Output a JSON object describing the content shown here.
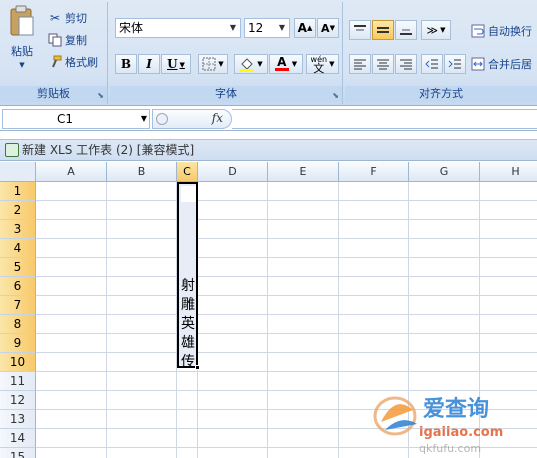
{
  "ribbon": {
    "clipboard": {
      "paste": "粘贴",
      "cut": "剪切",
      "copy": "复制",
      "format_painter": "格式刷",
      "group_label": "剪贴板"
    },
    "font": {
      "name": "宋体",
      "size": "12",
      "grow": "A",
      "shrink": "A",
      "bold": "B",
      "italic": "I",
      "underline": "U",
      "font_color_letter": "A",
      "phonetic": "wén",
      "group_label": "字体"
    },
    "alignment": {
      "wrap_text": "自动换行",
      "merge_center": "合并后居",
      "group_label": "对齐方式"
    }
  },
  "formula_bar": {
    "name_box": "C1",
    "fx": "fx",
    "value": ""
  },
  "window": {
    "title": "新建 XLS 工作表 (2)  [兼容模式]"
  },
  "sheet": {
    "columns": [
      "A",
      "B",
      "C",
      "D",
      "E",
      "F",
      "G",
      "H"
    ],
    "rows": [
      "1",
      "2",
      "3",
      "4",
      "5",
      "6",
      "7",
      "8",
      "9",
      "10",
      "11",
      "12",
      "13",
      "14",
      "15"
    ],
    "selected_column": "C",
    "selected_rows": [
      "1",
      "2",
      "3",
      "4",
      "5",
      "6",
      "7",
      "8",
      "9",
      "10"
    ],
    "vertical_text": [
      "射",
      "雕",
      "英",
      "雄",
      "传"
    ]
  },
  "watermark": {
    "brand": "爱查询",
    "url": "igaiiao.com",
    "url2": "qkfufu.com"
  },
  "colors": {
    "ribbon_bg": "#dfe9f5",
    "selected_header": "#f8c96a",
    "selection_fill": "#e7ecf6"
  }
}
